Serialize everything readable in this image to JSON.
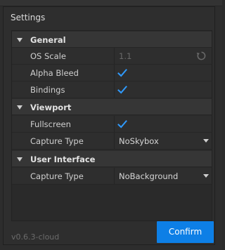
{
  "dialog": {
    "title": "Settings",
    "version": "v0.6.3-cloud",
    "confirm_label": "Confirm",
    "accent_color": "#0d7fe6"
  },
  "sections": {
    "general": {
      "label": "General",
      "os_scale": {
        "name": "OS Scale",
        "value": "1.1",
        "disabled": true,
        "icon": "reset-icon"
      },
      "alpha_bleed": {
        "name": "Alpha Bleed",
        "checked": true
      },
      "bindings": {
        "name": "Bindings",
        "checked": true
      }
    },
    "viewport": {
      "label": "Viewport",
      "fullscreen": {
        "name": "Fullscreen",
        "checked": true
      },
      "capture_type": {
        "name": "Capture Type",
        "value": "NoSkybox"
      }
    },
    "user_interface": {
      "label": "User Interface",
      "capture_type": {
        "name": "Capture Type",
        "value": "NoBackground"
      }
    }
  }
}
